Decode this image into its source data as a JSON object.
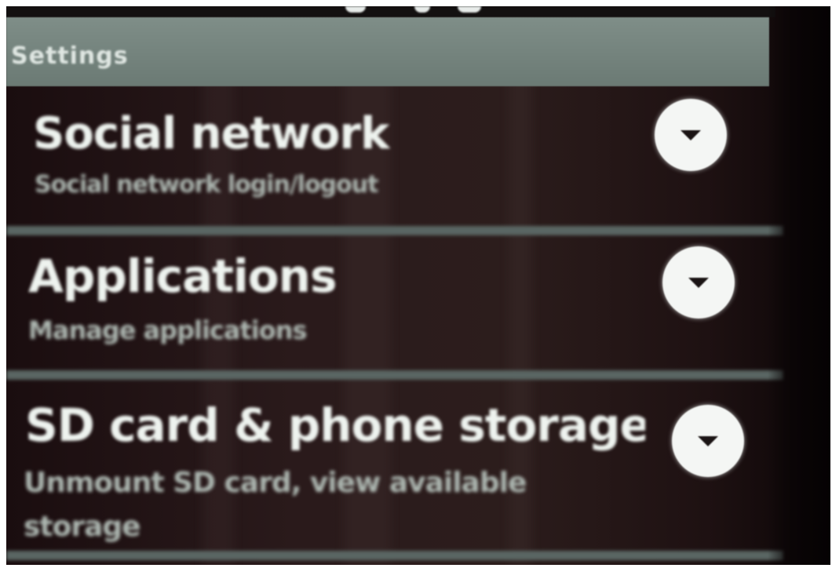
{
  "header": {
    "title": "Settings"
  },
  "settings": [
    {
      "title": "Social network",
      "summary": "Social network login/logout",
      "icon": "chevron-down-icon"
    },
    {
      "title": "Applications",
      "summary": "Manage applications",
      "icon": "chevron-down-icon"
    },
    {
      "title": "SD card & phone storage",
      "summary": "Unmount SD card, view available storage",
      "icon": "chevron-down-icon"
    }
  ],
  "colors": {
    "header_bar": "#7f8e88",
    "background": "#2a1a1b",
    "text": "#eef3ef",
    "summary_text": "#aeb8b2",
    "divider": "#5a6663"
  }
}
